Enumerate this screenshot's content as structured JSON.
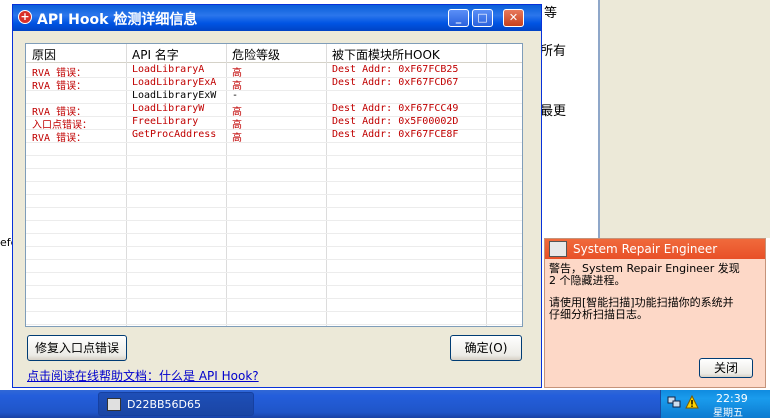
{
  "background": {
    "right_texts": [
      "等",
      "所有",
      "最更"
    ],
    "left_fragment": "efe"
  },
  "dialog": {
    "title": "API Hook 检测详细信息",
    "columns": [
      "原因",
      "API 名字",
      "危险等级",
      "被下面模块所HOOK"
    ],
    "rows": [
      {
        "reason": "RVA  错误：",
        "api": "LoadLibraryA",
        "risk": "高",
        "hook": "Dest Addr: 0xF67FCB25",
        "color": "red"
      },
      {
        "reason": "RVA  错误：",
        "api": "LoadLibraryExA",
        "risk": "高",
        "hook": "Dest Addr: 0xF67FCD67",
        "color": "red"
      },
      {
        "reason": "",
        "api": "LoadLibraryExW",
        "risk": "-",
        "hook": "",
        "color": "black"
      },
      {
        "reason": "RVA  错误：",
        "api": "LoadLibraryW",
        "risk": "高",
        "hook": "Dest Addr: 0xF67FCC49",
        "color": "red"
      },
      {
        "reason": "入口点错误：",
        "api": "FreeLibrary",
        "risk": "高",
        "hook": "Dest Addr: 0x5F00002D",
        "color": "red"
      },
      {
        "reason": "RVA  错误：",
        "api": "GetProcAddress",
        "risk": "高",
        "hook": "Dest Addr: 0xF67FCE8F",
        "color": "red"
      }
    ],
    "fix_button": "修复入口点错误",
    "ok_button": "确定(O)",
    "help_link": "点击阅读在线帮助文档：什么是 API Hook?"
  },
  "notification": {
    "title": "System Repair Engineer",
    "line1": "警告，System Repair Engineer 发现",
    "line2": " 2 个隐藏进程。",
    "line3": "请使用[智能扫描]功能扫描你的系统并",
    "line4": "仔细分析扫描日志。",
    "close_button": "关闭"
  },
  "taskbar": {
    "task_label": "D22BB56D65",
    "clock": "22:39",
    "clock_sub": "星期五"
  }
}
